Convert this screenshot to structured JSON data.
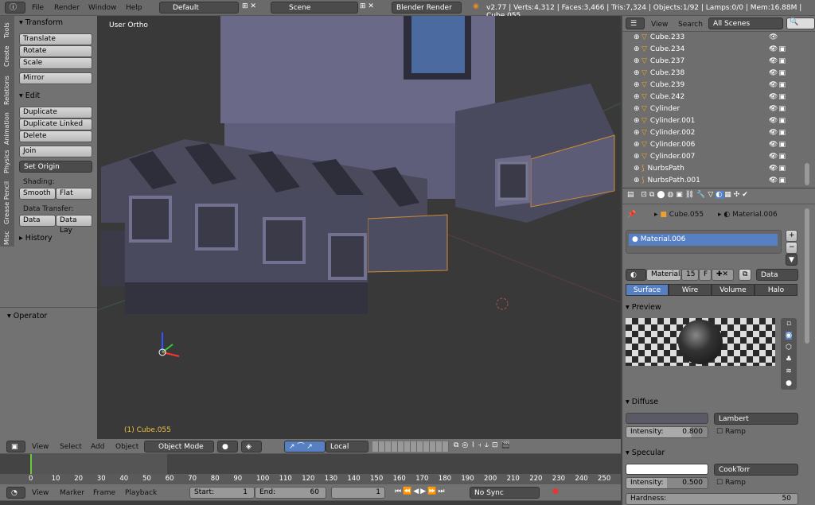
{
  "topbar": {
    "menus": [
      "File",
      "Render",
      "Window",
      "Help"
    ],
    "layout": "Default",
    "scene": "Scene",
    "engine": "Blender Render",
    "stats": "v2.77 | Verts:4,312 | Faces:3,466 | Tris:7,324 | Objects:1/92 | Lamps:0/0 | Mem:16.88M | Cube.055"
  },
  "toolshelf": {
    "tabs": [
      "Tools",
      "Create",
      "Relations",
      "Animation",
      "Physics",
      "Grease Pencil",
      "Misc"
    ],
    "transform": {
      "title": "Transform",
      "buttons": [
        "Translate",
        "Rotate",
        "Scale",
        "Mirror"
      ]
    },
    "edit": {
      "title": "Edit",
      "buttons": [
        "Duplicate",
        "Duplicate Linked",
        "Delete",
        "Join"
      ],
      "set_origin": "Set Origin",
      "shading_label": "Shading:",
      "smooth": "Smooth",
      "flat": "Flat",
      "data_transfer_label": "Data Transfer:",
      "data": "Data",
      "data_lay": "Data Lay"
    },
    "history": "History",
    "operator": "Operator"
  },
  "viewport": {
    "label": "User Ortho",
    "object_label": "(1) Cube.055"
  },
  "view3d_header": {
    "menus": [
      "View",
      "Select",
      "Add",
      "Object"
    ],
    "mode": "Object Mode",
    "orientation": "Local"
  },
  "timeline": {
    "ticks": [
      "0",
      "10",
      "20",
      "30",
      "40",
      "50",
      "60",
      "70",
      "80",
      "90",
      "100",
      "110",
      "120",
      "130",
      "140",
      "150",
      "160",
      "170",
      "180",
      "190",
      "200",
      "210",
      "220",
      "230",
      "240",
      "250"
    ],
    "menus": [
      "View",
      "Marker",
      "Frame",
      "Playback"
    ],
    "start_label": "Start:",
    "start": "1",
    "end_label": "End:",
    "end": "60",
    "current": "1",
    "sync": "No Sync"
  },
  "outliner": {
    "menus": [
      "View",
      "Search"
    ],
    "filter": "All Scenes",
    "items": [
      "Cube.233",
      "Cube.234",
      "Cube.237",
      "Cube.238",
      "Cube.239",
      "Cube.242",
      "Cylinder",
      "Cylinder.001",
      "Cylinder.002",
      "Cylinder.006",
      "Cylinder.007",
      "NurbsPath",
      "NurbsPath.001"
    ]
  },
  "properties": {
    "breadcrumb": [
      "Cube.055",
      "Material.006"
    ],
    "slot": "Material.006",
    "material_name": "Material.",
    "users": "15",
    "fake": "F",
    "link": "Data",
    "tabs": [
      "Surface",
      "Wire",
      "Volume",
      "Halo"
    ],
    "preview_title": "Preview",
    "diffuse": {
      "title": "Diffuse",
      "shader": "Lambert",
      "intensity_label": "Intensity:",
      "intensity": "0.800",
      "ramp": "Ramp",
      "color": "#5a5a66"
    },
    "specular": {
      "title": "Specular",
      "shader": "CookTorr",
      "intensity_label": "Intensity:",
      "intensity": "0.500",
      "ramp": "Ramp",
      "color": "#ffffff"
    },
    "hardness_label": "Hardness:",
    "hardness": "50"
  },
  "colors": {
    "accent": "#5680c2",
    "viewport_bg": "#393939",
    "panel": "#727272"
  }
}
